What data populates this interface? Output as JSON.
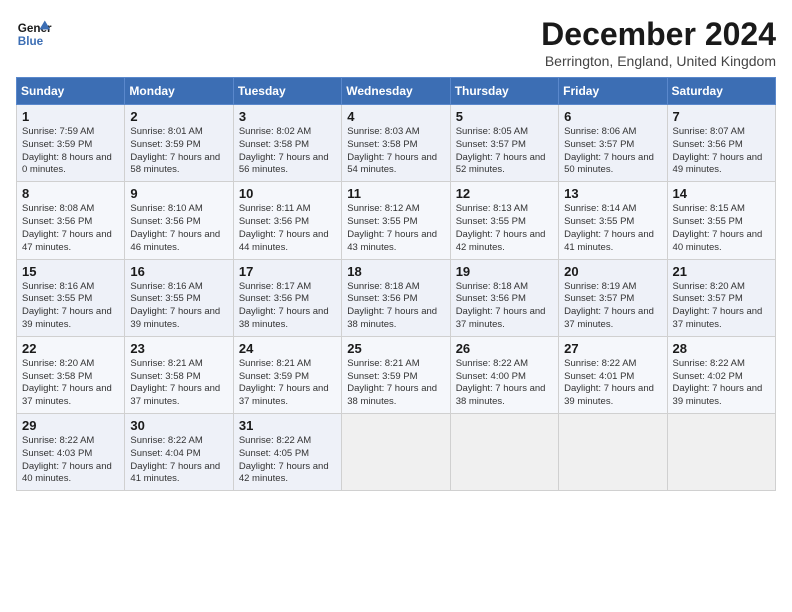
{
  "header": {
    "logo_line1": "General",
    "logo_line2": "Blue",
    "month_title": "December 2024",
    "location": "Berrington, England, United Kingdom"
  },
  "days_of_week": [
    "Sunday",
    "Monday",
    "Tuesday",
    "Wednesday",
    "Thursday",
    "Friday",
    "Saturday"
  ],
  "weeks": [
    [
      {
        "day": "1",
        "sunrise": "Sunrise: 7:59 AM",
        "sunset": "Sunset: 3:59 PM",
        "daylight": "Daylight: 8 hours and 0 minutes."
      },
      {
        "day": "2",
        "sunrise": "Sunrise: 8:01 AM",
        "sunset": "Sunset: 3:59 PM",
        "daylight": "Daylight: 7 hours and 58 minutes."
      },
      {
        "day": "3",
        "sunrise": "Sunrise: 8:02 AM",
        "sunset": "Sunset: 3:58 PM",
        "daylight": "Daylight: 7 hours and 56 minutes."
      },
      {
        "day": "4",
        "sunrise": "Sunrise: 8:03 AM",
        "sunset": "Sunset: 3:58 PM",
        "daylight": "Daylight: 7 hours and 54 minutes."
      },
      {
        "day": "5",
        "sunrise": "Sunrise: 8:05 AM",
        "sunset": "Sunset: 3:57 PM",
        "daylight": "Daylight: 7 hours and 52 minutes."
      },
      {
        "day": "6",
        "sunrise": "Sunrise: 8:06 AM",
        "sunset": "Sunset: 3:57 PM",
        "daylight": "Daylight: 7 hours and 50 minutes."
      },
      {
        "day": "7",
        "sunrise": "Sunrise: 8:07 AM",
        "sunset": "Sunset: 3:56 PM",
        "daylight": "Daylight: 7 hours and 49 minutes."
      }
    ],
    [
      {
        "day": "8",
        "sunrise": "Sunrise: 8:08 AM",
        "sunset": "Sunset: 3:56 PM",
        "daylight": "Daylight: 7 hours and 47 minutes."
      },
      {
        "day": "9",
        "sunrise": "Sunrise: 8:10 AM",
        "sunset": "Sunset: 3:56 PM",
        "daylight": "Daylight: 7 hours and 46 minutes."
      },
      {
        "day": "10",
        "sunrise": "Sunrise: 8:11 AM",
        "sunset": "Sunset: 3:56 PM",
        "daylight": "Daylight: 7 hours and 44 minutes."
      },
      {
        "day": "11",
        "sunrise": "Sunrise: 8:12 AM",
        "sunset": "Sunset: 3:55 PM",
        "daylight": "Daylight: 7 hours and 43 minutes."
      },
      {
        "day": "12",
        "sunrise": "Sunrise: 8:13 AM",
        "sunset": "Sunset: 3:55 PM",
        "daylight": "Daylight: 7 hours and 42 minutes."
      },
      {
        "day": "13",
        "sunrise": "Sunrise: 8:14 AM",
        "sunset": "Sunset: 3:55 PM",
        "daylight": "Daylight: 7 hours and 41 minutes."
      },
      {
        "day": "14",
        "sunrise": "Sunrise: 8:15 AM",
        "sunset": "Sunset: 3:55 PM",
        "daylight": "Daylight: 7 hours and 40 minutes."
      }
    ],
    [
      {
        "day": "15",
        "sunrise": "Sunrise: 8:16 AM",
        "sunset": "Sunset: 3:55 PM",
        "daylight": "Daylight: 7 hours and 39 minutes."
      },
      {
        "day": "16",
        "sunrise": "Sunrise: 8:16 AM",
        "sunset": "Sunset: 3:55 PM",
        "daylight": "Daylight: 7 hours and 39 minutes."
      },
      {
        "day": "17",
        "sunrise": "Sunrise: 8:17 AM",
        "sunset": "Sunset: 3:56 PM",
        "daylight": "Daylight: 7 hours and 38 minutes."
      },
      {
        "day": "18",
        "sunrise": "Sunrise: 8:18 AM",
        "sunset": "Sunset: 3:56 PM",
        "daylight": "Daylight: 7 hours and 38 minutes."
      },
      {
        "day": "19",
        "sunrise": "Sunrise: 8:18 AM",
        "sunset": "Sunset: 3:56 PM",
        "daylight": "Daylight: 7 hours and 37 minutes."
      },
      {
        "day": "20",
        "sunrise": "Sunrise: 8:19 AM",
        "sunset": "Sunset: 3:57 PM",
        "daylight": "Daylight: 7 hours and 37 minutes."
      },
      {
        "day": "21",
        "sunrise": "Sunrise: 8:20 AM",
        "sunset": "Sunset: 3:57 PM",
        "daylight": "Daylight: 7 hours and 37 minutes."
      }
    ],
    [
      {
        "day": "22",
        "sunrise": "Sunrise: 8:20 AM",
        "sunset": "Sunset: 3:58 PM",
        "daylight": "Daylight: 7 hours and 37 minutes."
      },
      {
        "day": "23",
        "sunrise": "Sunrise: 8:21 AM",
        "sunset": "Sunset: 3:58 PM",
        "daylight": "Daylight: 7 hours and 37 minutes."
      },
      {
        "day": "24",
        "sunrise": "Sunrise: 8:21 AM",
        "sunset": "Sunset: 3:59 PM",
        "daylight": "Daylight: 7 hours and 37 minutes."
      },
      {
        "day": "25",
        "sunrise": "Sunrise: 8:21 AM",
        "sunset": "Sunset: 3:59 PM",
        "daylight": "Daylight: 7 hours and 38 minutes."
      },
      {
        "day": "26",
        "sunrise": "Sunrise: 8:22 AM",
        "sunset": "Sunset: 4:00 PM",
        "daylight": "Daylight: 7 hours and 38 minutes."
      },
      {
        "day": "27",
        "sunrise": "Sunrise: 8:22 AM",
        "sunset": "Sunset: 4:01 PM",
        "daylight": "Daylight: 7 hours and 39 minutes."
      },
      {
        "day": "28",
        "sunrise": "Sunrise: 8:22 AM",
        "sunset": "Sunset: 4:02 PM",
        "daylight": "Daylight: 7 hours and 39 minutes."
      }
    ],
    [
      {
        "day": "29",
        "sunrise": "Sunrise: 8:22 AM",
        "sunset": "Sunset: 4:03 PM",
        "daylight": "Daylight: 7 hours and 40 minutes."
      },
      {
        "day": "30",
        "sunrise": "Sunrise: 8:22 AM",
        "sunset": "Sunset: 4:04 PM",
        "daylight": "Daylight: 7 hours and 41 minutes."
      },
      {
        "day": "31",
        "sunrise": "Sunrise: 8:22 AM",
        "sunset": "Sunset: 4:05 PM",
        "daylight": "Daylight: 7 hours and 42 minutes."
      },
      null,
      null,
      null,
      null
    ]
  ]
}
